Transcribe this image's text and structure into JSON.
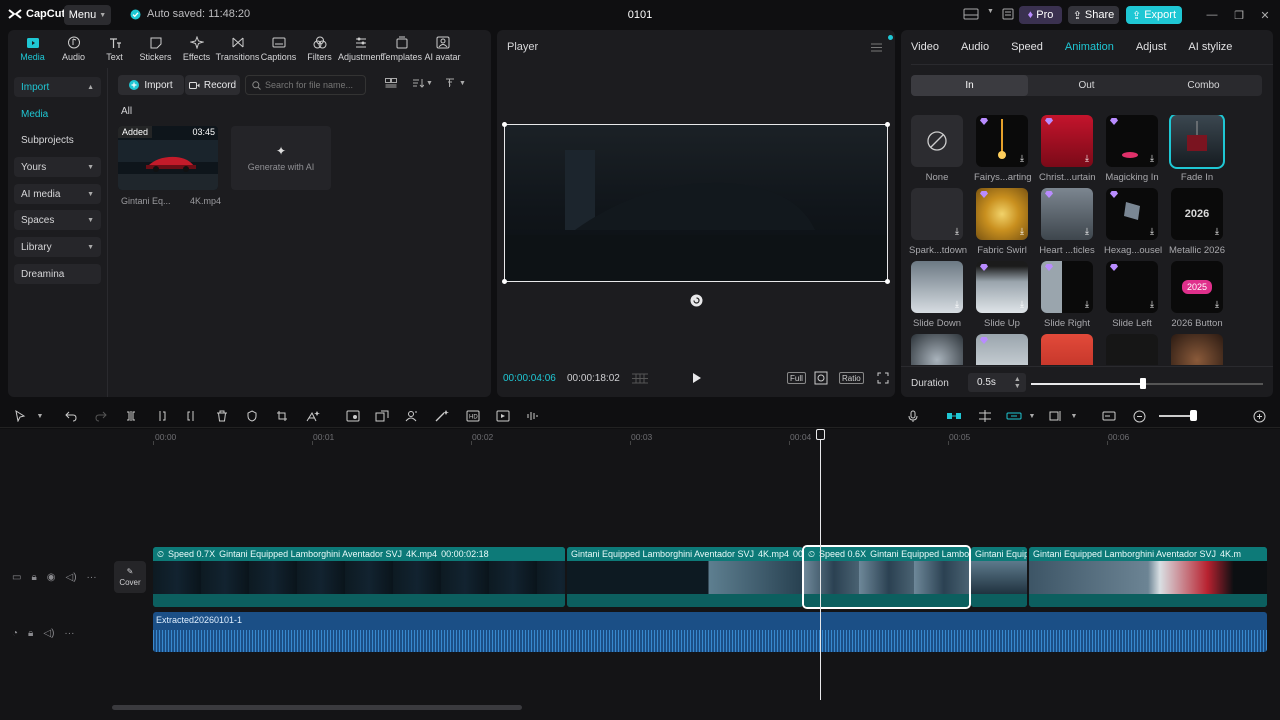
{
  "app": {
    "logo": "CapCut",
    "menu": "Menu",
    "autosave": "Auto saved: 11:48:20",
    "project_title": "0101",
    "pro": "Pro",
    "share": "Share",
    "export": "Export"
  },
  "colors": {
    "accent": "#1fc7d4",
    "panel": "#1c1c1f",
    "video_track": "#0b6a6a",
    "audio_track": "#1b4f86"
  },
  "tool_tabs": [
    {
      "label": "Media",
      "icon": "media-icon"
    },
    {
      "label": "Audio",
      "icon": "audio-icon"
    },
    {
      "label": "Text",
      "icon": "text-icon"
    },
    {
      "label": "Stickers",
      "icon": "stickers-icon"
    },
    {
      "label": "Effects",
      "icon": "effects-icon"
    },
    {
      "label": "Transitions",
      "icon": "transitions-icon"
    },
    {
      "label": "Captions",
      "icon": "captions-icon"
    },
    {
      "label": "Filters",
      "icon": "filters-icon"
    },
    {
      "label": "Adjustment",
      "icon": "adjustment-icon"
    },
    {
      "label": "Templates",
      "icon": "templates-icon"
    },
    {
      "label": "AI avatar",
      "icon": "ai-avatar-icon"
    }
  ],
  "sidebar": {
    "items": [
      {
        "label": "Import"
      },
      {
        "label": "Media"
      },
      {
        "label": "Subprojects"
      },
      {
        "label": "Yours"
      },
      {
        "label": "AI media"
      },
      {
        "label": "Spaces"
      },
      {
        "label": "Library"
      },
      {
        "label": "Dreamina"
      }
    ]
  },
  "media": {
    "import": "Import",
    "record": "Record",
    "search_placeholder": "Search for file name...",
    "all": "All",
    "card": {
      "badge": "Added",
      "duration": "03:45",
      "name": "Gintani Eq...",
      "name_suffix": "4K.mp4"
    },
    "generate": "Generate with AI"
  },
  "player": {
    "title": "Player",
    "current": "00:00:04:06",
    "total": "00:00:18:02",
    "full": "Full",
    "ratio": "Ratio"
  },
  "right_panel": {
    "tabs": [
      "Video",
      "Audio",
      "Speed",
      "Animation",
      "Adjust",
      "AI stylize"
    ],
    "subtabs": [
      "In",
      "Out",
      "Combo"
    ],
    "animations": [
      "None",
      "Fairys...arting",
      "Christ...urtain",
      "Magicking In",
      "Fade In",
      "Spark...tdown",
      "Fabric Swirl",
      "Heart ...ticles",
      "Hexag...ousel",
      "Metallic 2026",
      "Slide Down",
      "Slide Up",
      "Slide Right",
      "Slide Left",
      "2026 Button"
    ],
    "metallic_text": "2026",
    "button_text": "2025",
    "duration_label": "Duration",
    "duration_value": "0.5s"
  },
  "timeline": {
    "ruler": [
      "00:00",
      "00:01",
      "00:02",
      "00:03",
      "00:04",
      "00:05",
      "00:06"
    ],
    "cover": "Cover",
    "clips": [
      {
        "speed": "Speed 0.7X",
        "title": "Gintani Equipped Lamborghini Aventador SVJ",
        "ext": "4K.mp4",
        "dur": "00:00:02:18"
      },
      {
        "speed": "",
        "title": "Gintani Equipped Lamborghini Aventador SVJ",
        "ext": "4K.mp4",
        "dur": "00"
      },
      {
        "speed": "Speed 0.6X",
        "title": "Gintani Equipped Lambo",
        "ext": "",
        "dur": ""
      },
      {
        "speed": "",
        "title": "Gintani Equipp",
        "ext": "",
        "dur": ""
      },
      {
        "speed": "",
        "title": "Gintani Equipped Lamborghini Aventador SVJ",
        "ext": "4K.m",
        "dur": ""
      }
    ],
    "audio_label": "Extracted20260101-1"
  }
}
